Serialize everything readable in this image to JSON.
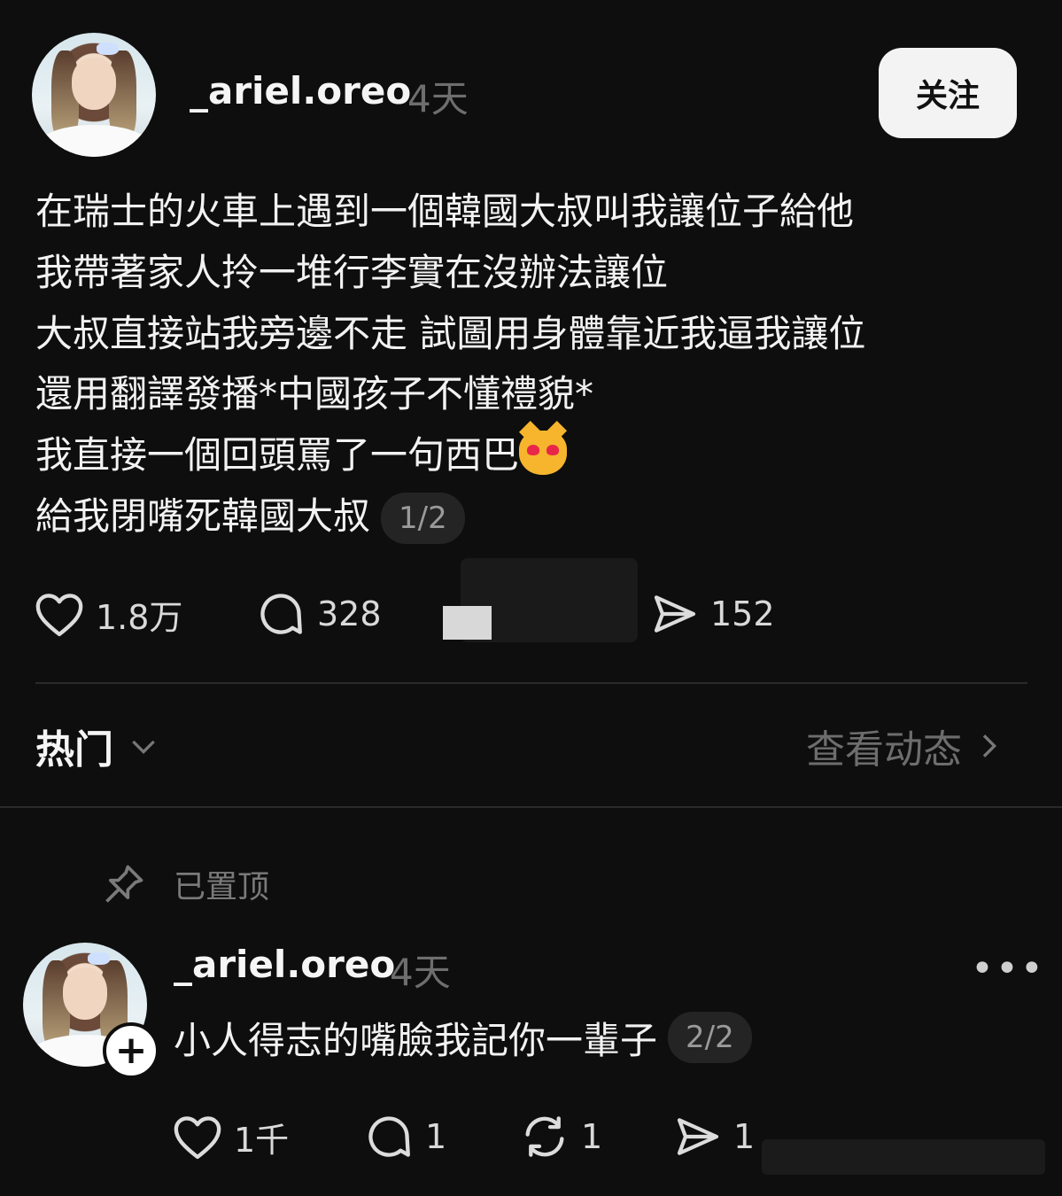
{
  "post": {
    "username": "_ariel.oreo",
    "time": "4天",
    "follow_label": "关注",
    "lines": [
      "在瑞士的火車上遇到一個韓國大叔叫我讓位子給他",
      "我帶著家人拎一堆行李實在沒辦法讓位",
      "大叔直接站我旁邊不走 試圖用身體靠近我逼我讓位",
      "還用翻譯發播*中國孩子不懂禮貌*",
      "我直接一個回頭罵了一句西巴",
      "給我閉嘴死韓國大叔"
    ],
    "emoji_name": "smiling-cat-heart-eyes",
    "pager": "1/2",
    "likes": "1.8万",
    "comments": "328",
    "shares": "152"
  },
  "feed": {
    "sort_label": "热门",
    "view_activity_label": "查看动态"
  },
  "reply": {
    "pinned_label": "已置顶",
    "username": "_ariel.oreo",
    "time": "4天",
    "text": "小人得志的嘴臉我記你一輩子",
    "pager": "2/2",
    "likes": "1千",
    "comments": "1",
    "reposts": "1",
    "shares": "1",
    "more_label": "•••"
  },
  "colors": {
    "background": "#0e0e0e",
    "text": "#f2f2f2",
    "muted": "#6e6e6e",
    "button_bg": "#f3f3f3"
  }
}
